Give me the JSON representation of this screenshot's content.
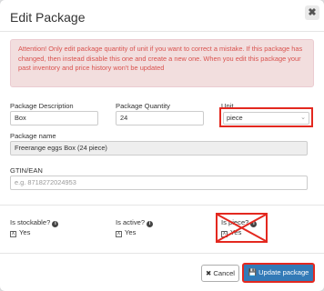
{
  "dialog": {
    "title": "Edit Package",
    "close_symbol": "✖"
  },
  "alert": {
    "text": "Attention! Only edit package quantity of unit if you want to correct a mistake. If this package has changed, then instead disable this one and create a new one. When you edit this package your past inventory and price history won't be updated"
  },
  "fields": {
    "description": {
      "label": "Package Description",
      "value": "Box"
    },
    "quantity": {
      "label": "Package Quantity",
      "value": "24"
    },
    "unit": {
      "label": "Unit",
      "value": "piece"
    },
    "name": {
      "label": "Package name",
      "value": "Freerange eggs Box (24 piece)"
    },
    "gtin": {
      "label": "GTIN/EAN",
      "placeholder": "e.g. 8718272024953"
    }
  },
  "checks": {
    "stockable": {
      "label": "Is stockable?",
      "value": "Yes",
      "mark": "X"
    },
    "active": {
      "label": "Is active?",
      "value": "Yes",
      "mark": "X"
    },
    "piece": {
      "label": "Is piece?",
      "value": "Yes",
      "mark": "X"
    }
  },
  "buttons": {
    "cancel": "Cancel",
    "update": "Update package"
  },
  "icons": {
    "info": "info-icon",
    "cancel": "times-icon",
    "save": "floppy-icon"
  },
  "colors": {
    "alert_text": "#d9534f",
    "alert_bg": "#f2dede",
    "primary": "#337ab7",
    "highlight": "#e3281f"
  }
}
